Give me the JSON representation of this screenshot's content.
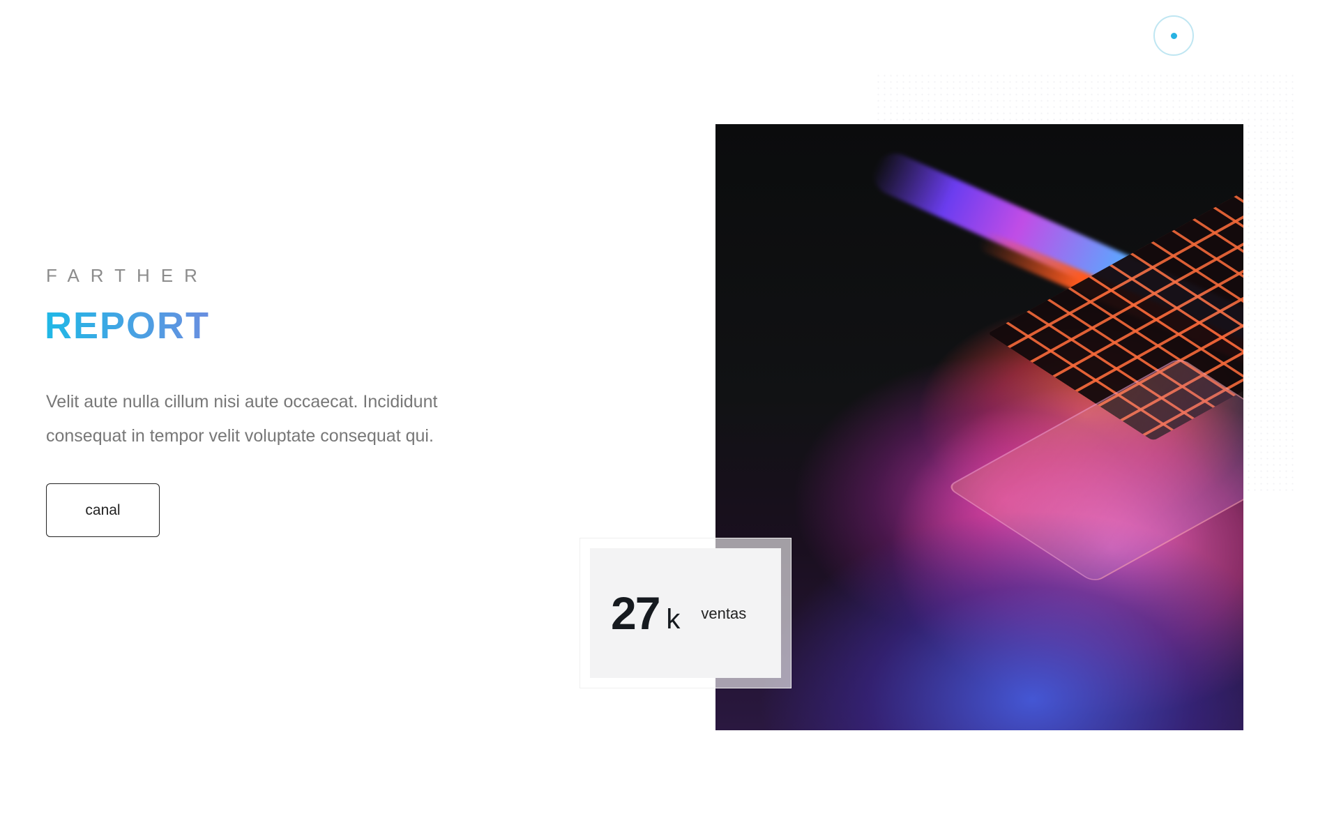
{
  "hero": {
    "eyebrow": "FARTHER",
    "title": "REPORT",
    "description": "Velit aute nulla cillum nisi aute occaecat. Incididunt consequat in tempor velit voluptate consequat qui.",
    "button_label": "canal"
  },
  "stat": {
    "number": "27",
    "unit": "k",
    "label": "ventas"
  },
  "colors": {
    "accent": "#27b2e2",
    "title_gradient_start": "#1fb8e6",
    "title_gradient_end": "#6a8ee0"
  },
  "icons": {
    "top_right": "circle-dot-icon",
    "hero_image": "laptop-keyboard-photo"
  }
}
